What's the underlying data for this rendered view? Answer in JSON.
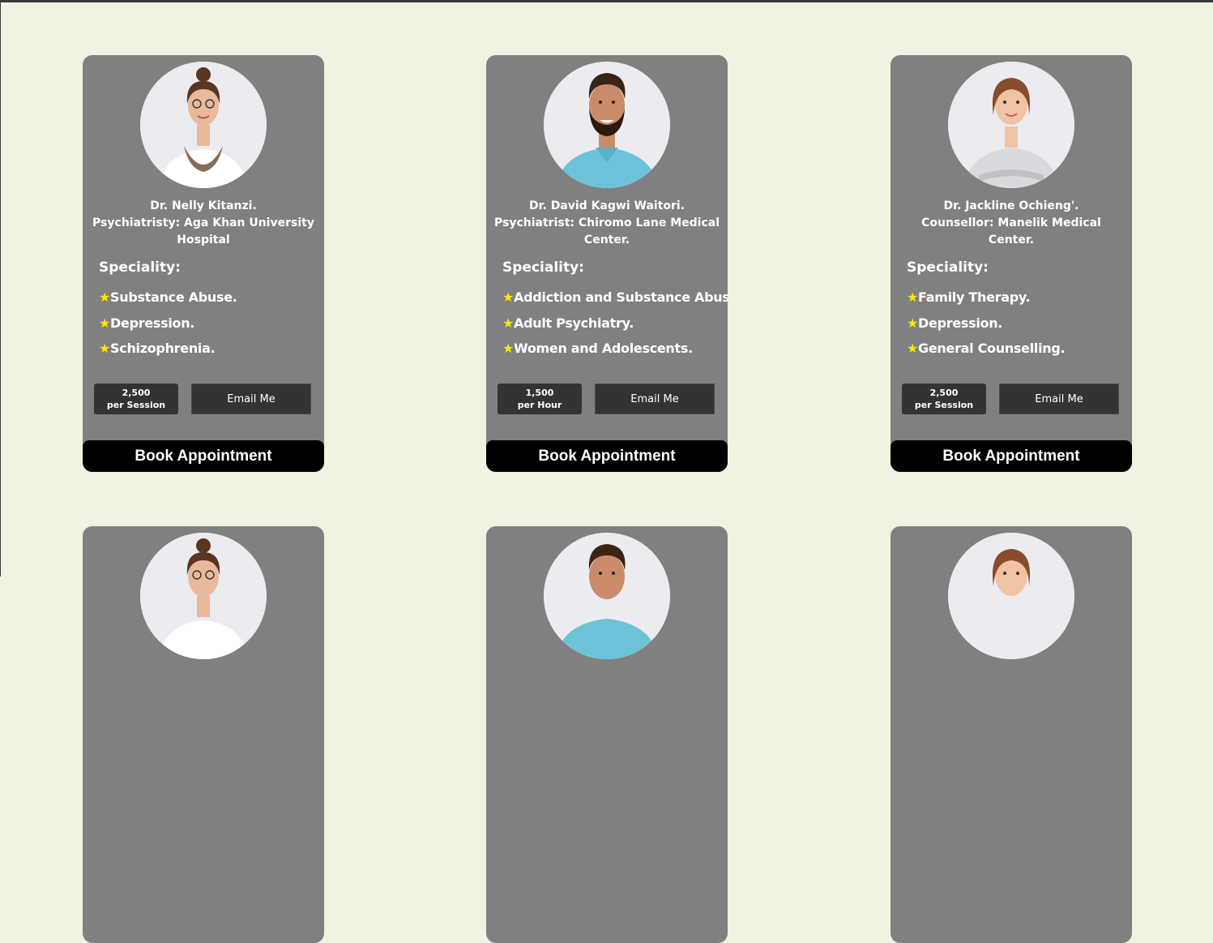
{
  "cards": [
    {
      "name": "Dr. Nelly Kitanzi.",
      "role": "Psychiatristy: Aga Khan University Hospital",
      "specialty_label": "Speciality:",
      "star": "★",
      "specialties": [
        "Substance Abuse.",
        "Depression.",
        "Schizophrenia."
      ],
      "price": "2,500",
      "price_unit": "per Session",
      "email_label": "Email Me",
      "book_label": "Book Appointment",
      "avatar": {
        "icon": "woman-glasses-scarf-portrait",
        "hair": "#5a3522",
        "skin": "#e8b99a",
        "top": "#ffffff",
        "accent": "#8b6a5a"
      }
    },
    {
      "name": "Dr. David Kagwi Waitori.",
      "role": "Psychiatrist: Chiromo Lane Medical Center.",
      "specialty_label": "Speciality:",
      "star": "★",
      "specialties": [
        "Addiction and Substance Abuse.",
        "Adult Psychiatry.",
        "Women and Adolescents."
      ],
      "price": "1,500",
      "price_unit": "per Hour",
      "email_label": "Email Me",
      "book_label": "Book Appointment",
      "avatar": {
        "icon": "man-beard-portrait",
        "hair": "#3a2416",
        "skin": "#c98b6a",
        "top": "#6cc3d8",
        "accent": "#2b1a10"
      }
    },
    {
      "name": "Dr. Jackline Ochieng'.",
      "role": "Counsellor: Manelik Medical Center.",
      "specialty_label": "Speciality:",
      "star": "★",
      "specialties": [
        "Family Therapy.",
        "Depression.",
        "General Counselling."
      ],
      "price": "2,500",
      "price_unit": "per Session",
      "email_label": "Email Me",
      "book_label": "Book Appointment",
      "avatar": {
        "icon": "woman-short-hair-portrait",
        "hair": "#8a4a2c",
        "skin": "#efc3a4",
        "top": "#d9d9df",
        "accent": "#c0c0c8"
      }
    },
    {
      "avatar": {
        "icon": "woman-glasses-scarf-portrait",
        "hair": "#5a3522",
        "skin": "#e8b99a",
        "top": "#ffffff",
        "accent": "#8b6a5a"
      }
    },
    {
      "avatar": {
        "icon": "man-beard-portrait",
        "hair": "#3a2416",
        "skin": "#c98b6a",
        "top": "#6cc3d8",
        "accent": "#2b1a10"
      }
    },
    {
      "avatar": {
        "icon": "woman-short-hair-portrait",
        "hair": "#8a4a2c",
        "skin": "#efc3a4",
        "top": "#d9d9df",
        "accent": "#c0c0c8"
      }
    }
  ]
}
